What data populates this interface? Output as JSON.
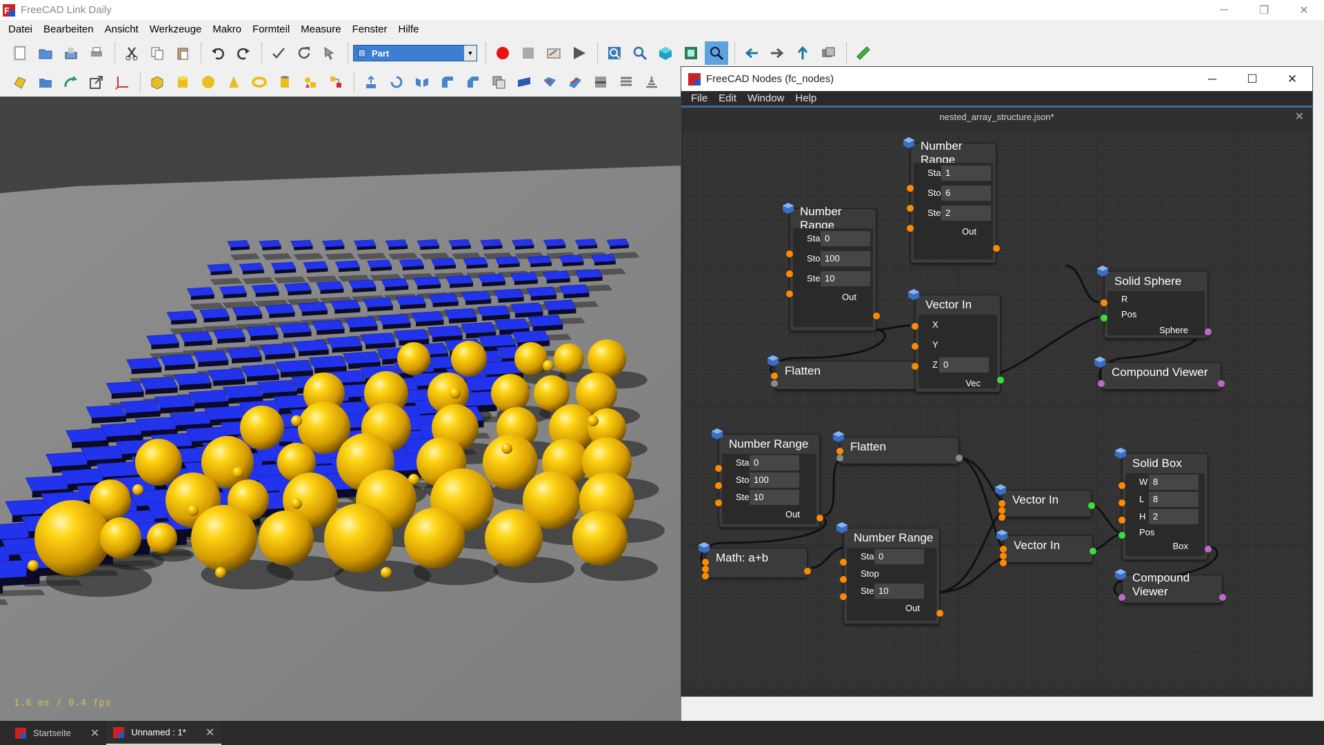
{
  "window": {
    "title": "FreeCAD Link Daily",
    "minimize": "─",
    "maximize": "❐",
    "close": "✕"
  },
  "menubar": [
    "Datei",
    "Bearbeiten",
    "Ansicht",
    "Werkzeuge",
    "Makro",
    "Formteil",
    "Measure",
    "Fenster",
    "Hilfe"
  ],
  "workbench": {
    "selected": "Part"
  },
  "viewport": {
    "fps_text": "1.6 ms / 0.4 fps"
  },
  "tabs": [
    {
      "label": "Startseite",
      "close": "✕"
    },
    {
      "label": "Unnamed : 1*",
      "close": "✕"
    }
  ],
  "nodes_window": {
    "title": "FreeCAD Nodes (fc_nodes)",
    "minimize": "─",
    "maximize": "☐",
    "close": "✕",
    "menu": [
      "File",
      "Edit",
      "Window",
      "Help"
    ],
    "file_tab": "nested_array_structure.json*",
    "file_close": "✕"
  },
  "nodes": {
    "nr_top": {
      "title": "Number Range",
      "start_label": "Start",
      "start": "1",
      "stop_label": "Stop",
      "stop": "6",
      "step_label": "Step",
      "step": "2",
      "out": "Out"
    },
    "nr_a": {
      "title": "Number Range",
      "start_label": "Start",
      "start": "0",
      "stop_label": "Stop",
      "stop": "100",
      "step_label": "Step",
      "step": "10",
      "out": "Out"
    },
    "flatten_a": {
      "title": "Flatten"
    },
    "vec_a": {
      "title": "Vector In",
      "x": "X",
      "y": "Y",
      "z": "Z",
      "z_val": "0",
      "out": "Vec"
    },
    "sphere": {
      "title": "Solid Sphere",
      "r": "R",
      "pos": "Pos",
      "out": "Sphere"
    },
    "cv_a": {
      "title": "Compound Viewer"
    },
    "nr_b": {
      "title": "Number Range",
      "start_label": "Start",
      "start": "0",
      "stop_label": "Stop",
      "stop": "100",
      "step_label": "Step",
      "step": "10",
      "out": "Out"
    },
    "flatten_b": {
      "title": "Flatten"
    },
    "math": {
      "title": "Math: a+b"
    },
    "nr_c": {
      "title": "Number Range",
      "start_label": "Start",
      "start": "0",
      "stop_label": "Stop",
      "stop": "",
      "step_label": "Step",
      "step": "10",
      "out": "Out"
    },
    "vec_b": {
      "title": "Vector In"
    },
    "vec_c": {
      "title": "Vector In"
    },
    "box": {
      "title": "Solid Box",
      "w_label": "W",
      "w": "8",
      "l_label": "L",
      "l": "8",
      "h_label": "H",
      "h": "2",
      "pos": "Pos",
      "out": "Box"
    },
    "cv_b": {
      "title": "Compound Viewer"
    }
  },
  "colors": {
    "port_float": "#ff8a00",
    "port_vector": "#3ddc3d",
    "port_shape": "#c266d0",
    "spheres": "#e6b800",
    "boxes": "#2233ee"
  }
}
